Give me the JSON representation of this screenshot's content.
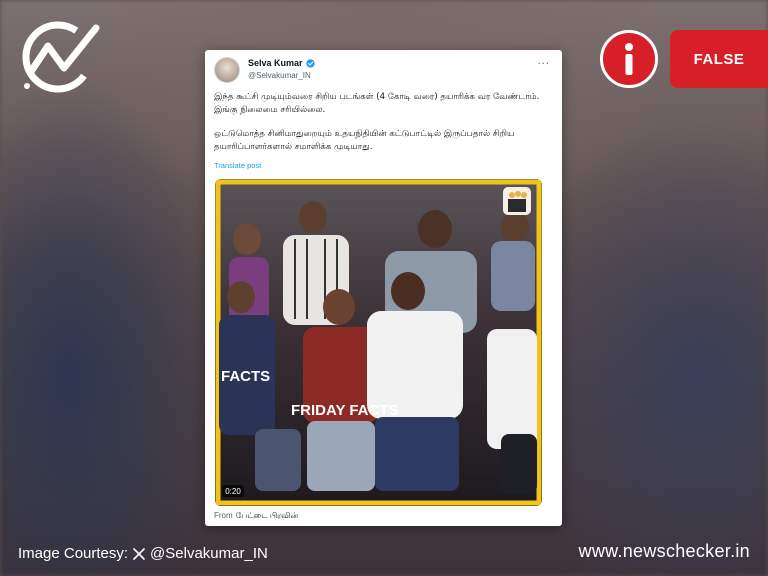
{
  "branding": {
    "site_url": "www.newschecker.in",
    "courtesy_label": "Image Courtesy:",
    "courtesy_handle": "@Selvakumar_IN",
    "verdict": "FALSE",
    "verdict_color": "#d61f26"
  },
  "tweet": {
    "display_name": "Selva Kumar",
    "handle": "@Selvakumar_IN",
    "verified": true,
    "paragraphs": [
      "இந்த கூட்சி முடியும்வரை சிறிய படங்கள் (4 கோடி வரை) தயாரிக்க வர வேண்டாம். இங்கு நிலைமை சரியில்லை.",
      "ஒட்டுமொத்த சினிமாதுறையும் உதயநிதியின் கட்டுபாட்டில் இருப்பதால் சிறிய தயாரிப்பாளர்களால் சமாளிக்க முடியாது."
    ],
    "translate_label": "Translate post",
    "video": {
      "overlay_primary": "FRIDAY FACTS",
      "overlay_secondary": "FACTS",
      "timestamp": "0:20"
    },
    "footer_label": "From",
    "footer_source": "பேட்டை பிரவின்"
  }
}
